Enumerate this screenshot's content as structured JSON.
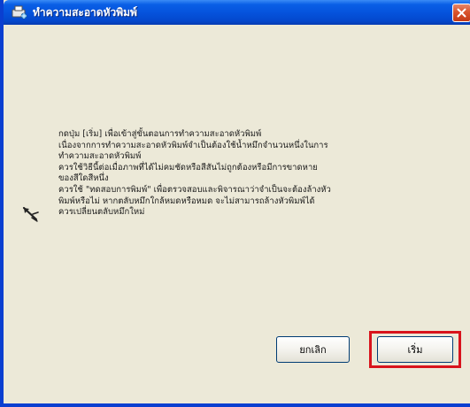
{
  "window": {
    "title": "ทำความสะอาดหัวพิมพ์",
    "close_icon": "close-icon"
  },
  "message": {
    "lines": [
      "กดปุ่ม [เริ่ม] เพื่อเข้าสู่ขั้นตอนการทำความสะอาดหัวพิมพ์",
      "เนื่องจากการทำความสะอาดหัวพิมพ์จำเป็นต้องใช้น้ำหมึกจำนวนหนึ่งในการ",
      "ทำความสะอาดหัวพิมพ์",
      "ควรใช้วิธีนี้ต่อเมื่อภาพที่ได้ไม่คมชัดหรือสีสันไม่ถูกต้องหรือมีการขาดหาย",
      "ของสีใดสีหนึ่ง",
      "ควรใช้ \"ทดสอบการพิมพ์\" เพื่อตรวจสอบและพิจารณาว่าจำเป็นจะต้องล้างหัว",
      "พิมพ์หรือไม่ หากตลับหมึกใกล้หมดหรือหมด จะไม่สามารถล้างหัวพิมพ์ได้",
      "ควรเปลี่ยนตลับหมึกใหม่"
    ]
  },
  "buttons": {
    "cancel_label": "ยกเลิก",
    "start_label": "เริ่ม"
  },
  "colors": {
    "titlebar": "#0553dd",
    "highlight": "#d8141c",
    "dialog_bg": "#ece9d8"
  }
}
